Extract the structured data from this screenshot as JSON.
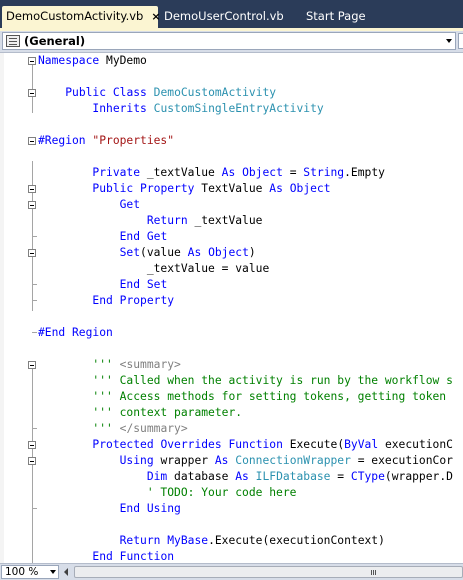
{
  "tabs": [
    {
      "label": "DemoCustomActivity.vb",
      "active": true,
      "close": "×"
    },
    {
      "label": "DemoUserControl.vb",
      "active": false
    },
    {
      "label": "Start Page",
      "active": false
    }
  ],
  "member_dropdown": {
    "selected": "(General)"
  },
  "zoom": {
    "value": "100 %"
  },
  "colors": {
    "keyword": "#0000ff",
    "type": "#2b91af",
    "string": "#a31515",
    "comment": "#008000",
    "xmldoc_tag": "#808080",
    "tab_strip": "#2b3c59",
    "active_tab": "#fbf5d2"
  },
  "code_lines": [
    {
      "tokens": [
        {
          "t": "Namespace",
          "k": "kw"
        },
        {
          "t": " MyDemo"
        }
      ]
    },
    {
      "tokens": []
    },
    {
      "tokens": [
        {
          "t": "    "
        },
        {
          "t": "Public",
          "k": "kw"
        },
        {
          "t": " "
        },
        {
          "t": "Class",
          "k": "kw"
        },
        {
          "t": " "
        },
        {
          "t": "DemoCustomActivity",
          "k": "ty"
        }
      ]
    },
    {
      "tokens": [
        {
          "t": "        "
        },
        {
          "t": "Inherits",
          "k": "kw"
        },
        {
          "t": " "
        },
        {
          "t": "CustomSingleEntryActivity",
          "k": "ty"
        }
      ]
    },
    {
      "tokens": []
    },
    {
      "tokens": [
        {
          "t": "#Region",
          "k": "kw"
        },
        {
          "t": " "
        },
        {
          "t": "\"Properties\"",
          "k": "st"
        }
      ]
    },
    {
      "tokens": []
    },
    {
      "tokens": [
        {
          "t": "        "
        },
        {
          "t": "Private",
          "k": "kw"
        },
        {
          "t": " _textValue "
        },
        {
          "t": "As",
          "k": "kw"
        },
        {
          "t": " "
        },
        {
          "t": "Object",
          "k": "kw"
        },
        {
          "t": " = "
        },
        {
          "t": "String",
          "k": "kw"
        },
        {
          "t": ".Empty"
        }
      ]
    },
    {
      "tokens": [
        {
          "t": "        "
        },
        {
          "t": "Public",
          "k": "kw"
        },
        {
          "t": " "
        },
        {
          "t": "Property",
          "k": "kw"
        },
        {
          "t": " TextValue "
        },
        {
          "t": "As",
          "k": "kw"
        },
        {
          "t": " "
        },
        {
          "t": "Object",
          "k": "kw"
        }
      ]
    },
    {
      "tokens": [
        {
          "t": "            "
        },
        {
          "t": "Get",
          "k": "kw"
        }
      ]
    },
    {
      "tokens": [
        {
          "t": "                "
        },
        {
          "t": "Return",
          "k": "kw"
        },
        {
          "t": " _textValue"
        }
      ]
    },
    {
      "tokens": [
        {
          "t": "            "
        },
        {
          "t": "End",
          "k": "kw"
        },
        {
          "t": " "
        },
        {
          "t": "Get",
          "k": "kw"
        }
      ]
    },
    {
      "tokens": [
        {
          "t": "            "
        },
        {
          "t": "Set",
          "k": "kw"
        },
        {
          "t": "(value "
        },
        {
          "t": "As",
          "k": "kw"
        },
        {
          "t": " "
        },
        {
          "t": "Object",
          "k": "kw"
        },
        {
          "t": ")"
        }
      ]
    },
    {
      "tokens": [
        {
          "t": "                _textValue = value"
        }
      ]
    },
    {
      "tokens": [
        {
          "t": "            "
        },
        {
          "t": "End",
          "k": "kw"
        },
        {
          "t": " "
        },
        {
          "t": "Set",
          "k": "kw"
        }
      ]
    },
    {
      "tokens": [
        {
          "t": "        "
        },
        {
          "t": "End",
          "k": "kw"
        },
        {
          "t": " "
        },
        {
          "t": "Property",
          "k": "kw"
        }
      ]
    },
    {
      "tokens": []
    },
    {
      "tokens": [
        {
          "t": "#End Region",
          "k": "kw"
        }
      ]
    },
    {
      "tokens": []
    },
    {
      "tokens": [
        {
          "t": "        "
        },
        {
          "t": "'''",
          "k": "cm"
        },
        {
          "t": " "
        },
        {
          "t": "<summary>",
          "k": "xd"
        }
      ]
    },
    {
      "tokens": [
        {
          "t": "        "
        },
        {
          "t": "'''",
          "k": "cm"
        },
        {
          "t": " Called when the activity is run by the workflow s",
          "k": "cm"
        }
      ]
    },
    {
      "tokens": [
        {
          "t": "        "
        },
        {
          "t": "'''",
          "k": "cm"
        },
        {
          "t": " Access methods for setting tokens, getting token",
          "k": "cm"
        }
      ]
    },
    {
      "tokens": [
        {
          "t": "        "
        },
        {
          "t": "'''",
          "k": "cm"
        },
        {
          "t": " context parameter.",
          "k": "cm"
        }
      ]
    },
    {
      "tokens": [
        {
          "t": "        "
        },
        {
          "t": "'''",
          "k": "cm"
        },
        {
          "t": " "
        },
        {
          "t": "</summary>",
          "k": "xd"
        }
      ]
    },
    {
      "tokens": [
        {
          "t": "        "
        },
        {
          "t": "Protected",
          "k": "kw"
        },
        {
          "t": " "
        },
        {
          "t": "Overrides",
          "k": "kw"
        },
        {
          "t": " "
        },
        {
          "t": "Function",
          "k": "kw"
        },
        {
          "t": " Execute("
        },
        {
          "t": "ByVal",
          "k": "kw"
        },
        {
          "t": " executionC"
        }
      ]
    },
    {
      "tokens": [
        {
          "t": "            "
        },
        {
          "t": "Using",
          "k": "kw"
        },
        {
          "t": " wrapper "
        },
        {
          "t": "As",
          "k": "kw"
        },
        {
          "t": " "
        },
        {
          "t": "ConnectionWrapper",
          "k": "ty"
        },
        {
          "t": " = executionCor"
        }
      ]
    },
    {
      "tokens": [
        {
          "t": "                "
        },
        {
          "t": "Dim",
          "k": "kw"
        },
        {
          "t": " database "
        },
        {
          "t": "As",
          "k": "kw"
        },
        {
          "t": " "
        },
        {
          "t": "ILFDatabase",
          "k": "ty"
        },
        {
          "t": " = "
        },
        {
          "t": "CType",
          "k": "kw"
        },
        {
          "t": "(wrapper.D"
        }
      ]
    },
    {
      "tokens": [
        {
          "t": "                "
        },
        {
          "t": "' TODO: Your code here",
          "k": "cm"
        }
      ]
    },
    {
      "tokens": [
        {
          "t": "            "
        },
        {
          "t": "End",
          "k": "kw"
        },
        {
          "t": " "
        },
        {
          "t": "Using",
          "k": "kw"
        }
      ]
    },
    {
      "tokens": []
    },
    {
      "tokens": [
        {
          "t": "            "
        },
        {
          "t": "Return",
          "k": "kw"
        },
        {
          "t": " "
        },
        {
          "t": "MyBase",
          "k": "kw"
        },
        {
          "t": ".Execute(executionContext)"
        }
      ]
    },
    {
      "tokens": [
        {
          "t": "        "
        },
        {
          "t": "End",
          "k": "kw"
        },
        {
          "t": " "
        },
        {
          "t": "Function",
          "k": "kw"
        }
      ]
    }
  ]
}
